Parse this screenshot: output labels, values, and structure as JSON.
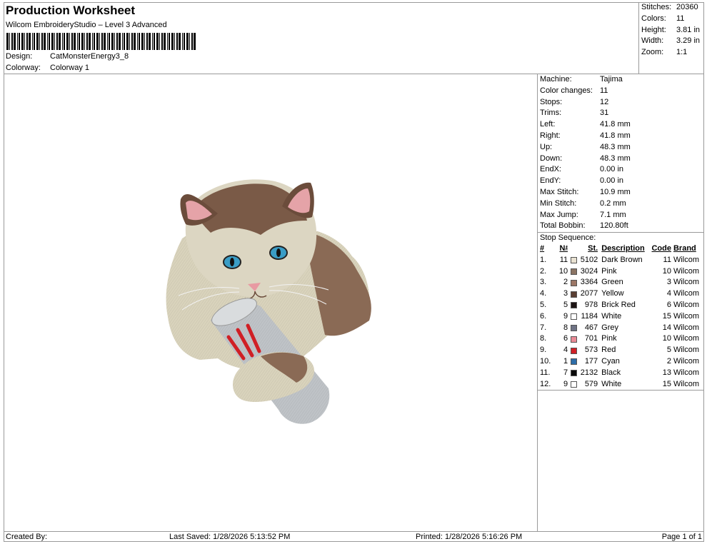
{
  "header": {
    "title": "Production Worksheet",
    "subtitle": "Wilcom EmbroideryStudio – Level 3 Advanced",
    "design_label": "Design:",
    "design_value": "CatMonsterEnergy3_8",
    "colorway_label": "Colorway:",
    "colorway_value": "Colorway 1"
  },
  "summary": [
    {
      "label": "Stitches:",
      "value": "20360"
    },
    {
      "label": "Colors:",
      "value": "11"
    },
    {
      "label": "Height:",
      "value": "3.81 in"
    },
    {
      "label": "Width:",
      "value": "3.29 in"
    },
    {
      "label": "Zoom:",
      "value": "1:1"
    }
  ],
  "machine_info": [
    {
      "label": "Machine:",
      "value": "Tajima"
    },
    {
      "label": "Color changes:",
      "value": "11"
    },
    {
      "label": "Stops:",
      "value": "12"
    },
    {
      "label": "Trims:",
      "value": "31"
    },
    {
      "label": "Left:",
      "value": "41.8 mm"
    },
    {
      "label": "Right:",
      "value": "41.8 mm"
    },
    {
      "label": "Up:",
      "value": "48.3 mm"
    },
    {
      "label": "Down:",
      "value": "48.3 mm"
    },
    {
      "label": "EndX:",
      "value": "0.00 in"
    },
    {
      "label": "EndY:",
      "value": "0.00 in"
    },
    {
      "label": "Max Stitch:",
      "value": "10.9 mm"
    },
    {
      "label": "Min Stitch:",
      "value": "0.2 mm"
    },
    {
      "label": "Max Jump:",
      "value": "7.1 mm"
    },
    {
      "label": "Total Bobbin:",
      "value": "120.80ft"
    }
  ],
  "stop_sequence": {
    "label": "Stop Sequence:",
    "headers": {
      "idx": "#",
      "n": "N#",
      "st": "St.",
      "desc": "Description",
      "code": "Code",
      "brand": "Brand"
    },
    "rows": [
      {
        "idx": "1.",
        "n": "11",
        "color": "#e9e2d2",
        "st": "5102",
        "desc": "Dark Brown",
        "code": "11",
        "brand": "Wilcom"
      },
      {
        "idx": "2.",
        "n": "10",
        "color": "#8b7464",
        "st": "3024",
        "desc": "Pink",
        "code": "10",
        "brand": "Wilcom"
      },
      {
        "idx": "3.",
        "n": "2",
        "color": "#9c7766",
        "st": "3364",
        "desc": "Green",
        "code": "3",
        "brand": "Wilcom"
      },
      {
        "idx": "4.",
        "n": "3",
        "color": "#5a3f33",
        "st": "2077",
        "desc": "Yellow",
        "code": "4",
        "brand": "Wilcom"
      },
      {
        "idx": "5.",
        "n": "5",
        "color": "#1c1414",
        "st": "978",
        "desc": "Brick Red",
        "code": "6",
        "brand": "Wilcom"
      },
      {
        "idx": "6.",
        "n": "9",
        "color": "#ffffff",
        "st": "1184",
        "desc": "White",
        "code": "15",
        "brand": "Wilcom"
      },
      {
        "idx": "7.",
        "n": "8",
        "color": "#6f7385",
        "st": "467",
        "desc": "Grey",
        "code": "14",
        "brand": "Wilcom"
      },
      {
        "idx": "8.",
        "n": "6",
        "color": "#e98a95",
        "st": "701",
        "desc": "Pink",
        "code": "10",
        "brand": "Wilcom"
      },
      {
        "idx": "9.",
        "n": "4",
        "color": "#d01f25",
        "st": "573",
        "desc": "Red",
        "code": "5",
        "brand": "Wilcom"
      },
      {
        "idx": "10.",
        "n": "1",
        "color": "#2d6da8",
        "st": "177",
        "desc": "Cyan",
        "code": "2",
        "brand": "Wilcom"
      },
      {
        "idx": "11.",
        "n": "7",
        "color": "#0a0a0a",
        "st": "2132",
        "desc": "Black",
        "code": "13",
        "brand": "Wilcom"
      },
      {
        "idx": "12.",
        "n": "9",
        "color": "#ffffff",
        "st": "579",
        "desc": "White",
        "code": "15",
        "brand": "Wilcom"
      }
    ]
  },
  "footer": {
    "created_by": "Created By:",
    "last_saved": "Last Saved: 1/28/2026 5:13:52 PM",
    "printed": "Printed: 1/28/2026 5:16:26 PM",
    "page": "Page 1 of 1"
  }
}
